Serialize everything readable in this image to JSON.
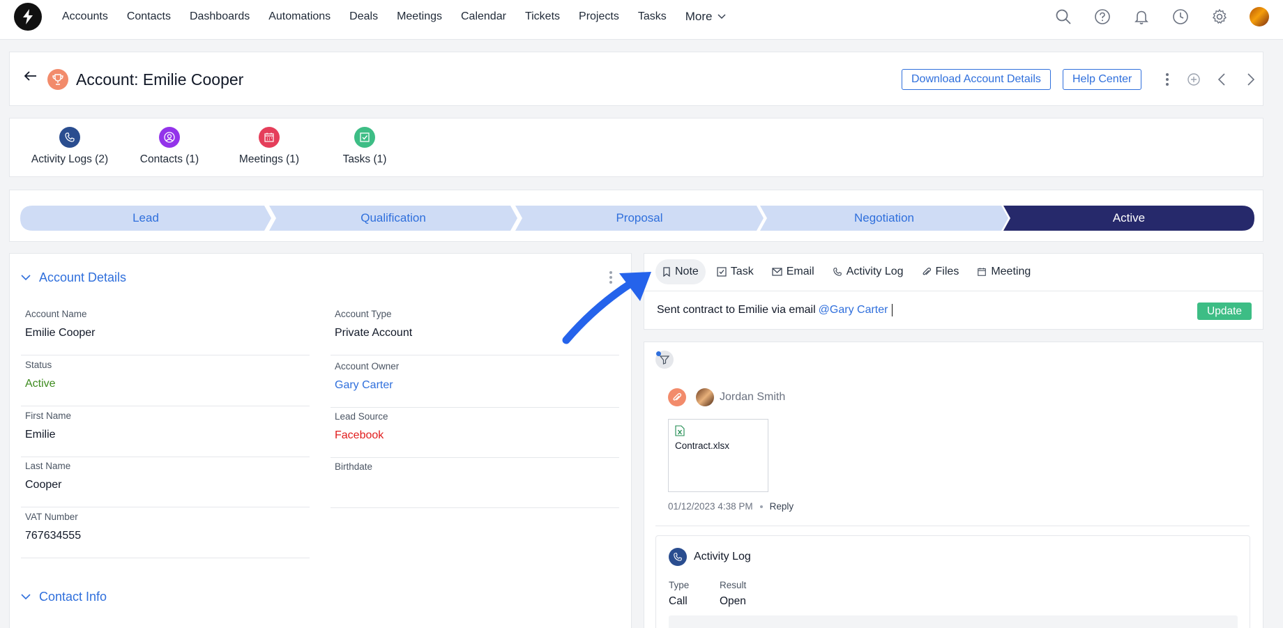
{
  "nav": {
    "items": [
      "Accounts",
      "Contacts",
      "Dashboards",
      "Automations",
      "Deals",
      "Meetings",
      "Calendar",
      "Tickets",
      "Projects",
      "Tasks"
    ],
    "more_label": "More",
    "icons": [
      "search-icon",
      "help-icon",
      "bell-icon",
      "clock-icon",
      "gear-icon",
      "user-avatar"
    ]
  },
  "header": {
    "title": "Account: Emilie Cooper",
    "download_label": "Download Account Details",
    "help_label": "Help Center"
  },
  "related": [
    {
      "label": "Activity Logs (2)",
      "color": "#2a4d8f",
      "icon": "phone-icon"
    },
    {
      "label": "Contacts (1)",
      "color": "#9333ea",
      "icon": "user-circle-icon"
    },
    {
      "label": "Meetings (1)",
      "color": "#e53e5a",
      "icon": "calendar-icon"
    },
    {
      "label": "Tasks (1)",
      "color": "#3dbd85",
      "icon": "checkbox-icon"
    }
  ],
  "stages": [
    {
      "label": "Lead",
      "active": false
    },
    {
      "label": "Qualification",
      "active": false
    },
    {
      "label": "Proposal",
      "active": false
    },
    {
      "label": "Negotiation",
      "active": false
    },
    {
      "label": "Active",
      "active": true
    }
  ],
  "account_details": {
    "section_title": "Account Details",
    "left": [
      {
        "label": "Account Name",
        "value": "Emilie Cooper"
      },
      {
        "label": "Status",
        "value": "Active"
      },
      {
        "label": "First Name",
        "value": "Emilie"
      },
      {
        "label": "Last Name",
        "value": "Cooper"
      },
      {
        "label": "VAT Number",
        "value": "767634555"
      }
    ],
    "right": [
      {
        "label": "Account Type",
        "value": "Private Account"
      },
      {
        "label": "Account Owner",
        "value": "Gary Carter"
      },
      {
        "label": "Lead Source",
        "value": "Facebook"
      },
      {
        "label": "Birthdate",
        "value": ""
      }
    ]
  },
  "contact_info": {
    "section_title": "Contact Info"
  },
  "composer": {
    "tabs": [
      "Note",
      "Task",
      "Email",
      "Activity Log",
      "Files",
      "Meeting"
    ],
    "text": "Sent contract to Emilie via email",
    "mention": "@Gary Carter",
    "update_label": "Update"
  },
  "feed": {
    "user": "Jordan Smith",
    "file_name": "Contract.xlsx",
    "timestamp": "01/12/2023 4:38 PM",
    "reply_label": "Reply",
    "activity": {
      "title": "Activity Log",
      "type_label": "Type",
      "type_value": "Call",
      "result_label": "Result",
      "result_value": "Open"
    }
  },
  "colors": {
    "accent": "#2f6fdc",
    "active_stage": "#26296b",
    "stage_bg": "#cfdcf5",
    "status_active": "#3d8b1e",
    "lead_source": "#e11d1d",
    "update_btn": "#3dbd85",
    "arrow": "#2563eb"
  }
}
